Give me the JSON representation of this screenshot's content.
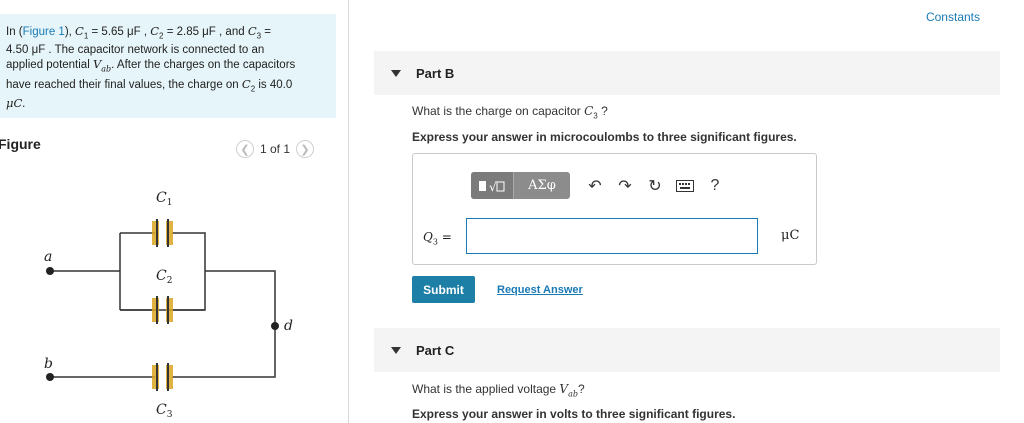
{
  "problem": {
    "lead": "In (",
    "figure_link": "Figure 1",
    "close": "),",
    "c1": "C",
    "c1_sub": "1",
    "c1_val": " = 5.65 μF , ",
    "c2": "C",
    "c2_sub": "2",
    "c2_val": " = 2.85 μF , and ",
    "c3": "C",
    "c3_sub": "3",
    "c3_val": " =",
    "line2": "4.50 μF . The capacitor network is connected to an",
    "line3a": "applied potential ",
    "vab": "V",
    "vab_sub": "ab",
    "line3b": ". After the charges on the capacitors",
    "line4": "have reached their final values, the charge on ",
    "line4_c": "C",
    "line4_sub": "2",
    "line4_b": " is 40.0",
    "line5": "μC."
  },
  "figure": {
    "title": "Figure",
    "pager": "1 of 1",
    "prev_icon": "chevron-left-icon",
    "next_icon": "chevron-right-icon",
    "labels": {
      "c1": "C",
      "c1_sub": "1",
      "c2": "C",
      "c2_sub": "2",
      "c3": "C",
      "c3_sub": "3",
      "a": "a",
      "b": "b",
      "d": "d"
    }
  },
  "header": {
    "constants": "Constants"
  },
  "partB": {
    "title": "Part B",
    "question_a": "What is the charge on capacitor ",
    "question_c": "C",
    "question_sub": "3",
    "question_b": " ?",
    "instruction": "Express your answer in microcoulombs to three significant figures.",
    "toolbar": {
      "template_icon": "templates-icon",
      "greek_label": "ΑΣφ",
      "undo_icon": "undo-icon",
      "redo_icon": "redo-icon",
      "reset_icon": "reset-icon",
      "keyboard_icon": "keyboard-icon",
      "help_label": "?"
    },
    "answer_label": "Q",
    "answer_sub": "3",
    "answer_eq": " =",
    "answer_value": "",
    "unit": "μC",
    "submit": "Submit",
    "request": "Request Answer"
  },
  "partC": {
    "title": "Part C",
    "question_a": "What is the applied voltage ",
    "question_v": "V",
    "question_sub": "ab",
    "question_b": "?",
    "instruction": "Express your answer in volts to three significant figures."
  },
  "colors": {
    "accent": "#1a7ab5",
    "button": "#1d7ea6",
    "problem_bg": "#e6f5f9",
    "capacitor": "#d9a521"
  }
}
